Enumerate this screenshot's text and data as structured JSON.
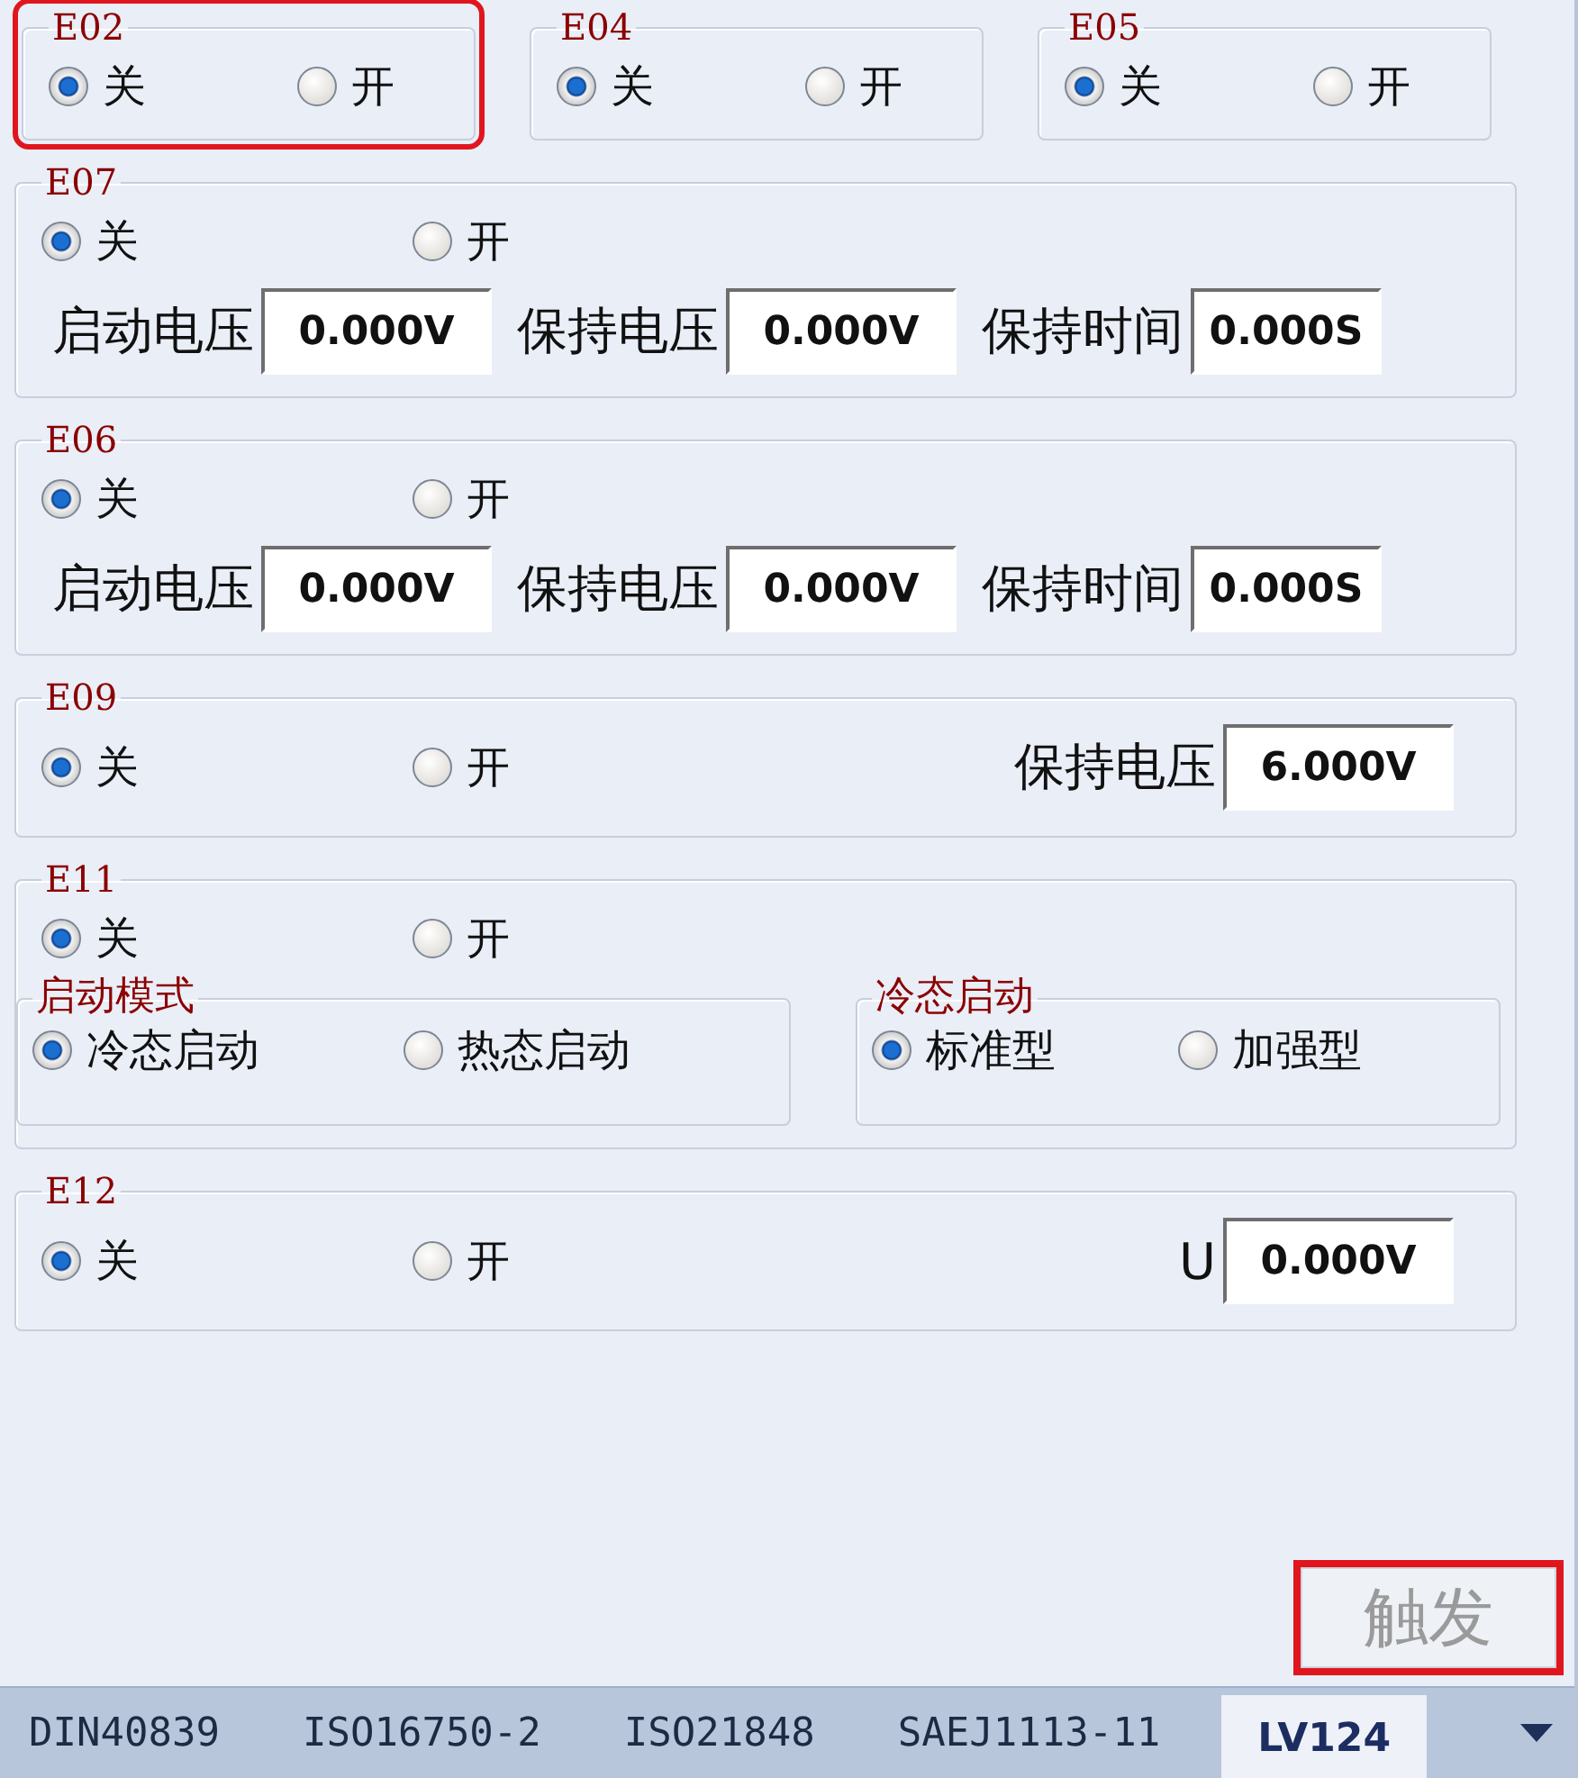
{
  "top_groups": [
    {
      "title": "E02",
      "highlighted": true,
      "options": [
        {
          "label": "关",
          "selected": true
        },
        {
          "label": "开",
          "selected": false
        }
      ]
    },
    {
      "title": "E04",
      "highlighted": false,
      "options": [
        {
          "label": "关",
          "selected": true
        },
        {
          "label": "开",
          "selected": false
        }
      ]
    },
    {
      "title": "E05",
      "highlighted": false,
      "options": [
        {
          "label": "关",
          "selected": true
        },
        {
          "label": "开",
          "selected": false
        }
      ]
    }
  ],
  "groups": [
    {
      "title": "E07",
      "kind": "timing",
      "options": [
        {
          "label": "关",
          "selected": true
        },
        {
          "label": "开",
          "selected": false
        }
      ],
      "fields": [
        {
          "label": "启动电压",
          "value": "0.000V"
        },
        {
          "label": "保持电压",
          "value": "0.000V"
        },
        {
          "label": "保持时间",
          "value": "0.000S"
        }
      ]
    },
    {
      "title": "E06",
      "kind": "timing",
      "options": [
        {
          "label": "关",
          "selected": true
        },
        {
          "label": "开",
          "selected": false
        }
      ],
      "fields": [
        {
          "label": "启动电压",
          "value": "0.000V"
        },
        {
          "label": "保持电压",
          "value": "0.000V"
        },
        {
          "label": "保持时间",
          "value": "0.000S"
        }
      ]
    },
    {
      "title": "E09",
      "kind": "inline",
      "options": [
        {
          "label": "关",
          "selected": true
        },
        {
          "label": "开",
          "selected": false
        }
      ],
      "fields": [
        {
          "label": "保持电压",
          "value": "6.000V"
        }
      ]
    },
    {
      "title": "E11",
      "kind": "modes",
      "options": [
        {
          "label": "关",
          "selected": true
        },
        {
          "label": "开",
          "selected": false
        }
      ],
      "subgroups": [
        {
          "title": "启动模式",
          "options": [
            {
              "label": "冷态启动",
              "selected": true
            },
            {
              "label": "热态启动",
              "selected": false
            }
          ]
        },
        {
          "title": "冷态启动",
          "options": [
            {
              "label": "标准型",
              "selected": true
            },
            {
              "label": "加强型",
              "selected": false
            }
          ]
        }
      ]
    },
    {
      "title": "E12",
      "kind": "inline",
      "options": [
        {
          "label": "关",
          "selected": true
        },
        {
          "label": "开",
          "selected": false
        }
      ],
      "fields": [
        {
          "label": "U",
          "value": "0.000V"
        }
      ]
    }
  ],
  "trigger_button": {
    "label": "触发",
    "disabled": true,
    "highlighted": true
  },
  "tabs": [
    {
      "label": "DIN40839",
      "selected": false
    },
    {
      "label": "ISO16750-2",
      "selected": false
    },
    {
      "label": "ISO21848",
      "selected": false
    },
    {
      "label": "SAEJ1113-11",
      "selected": false
    },
    {
      "label": "LV124",
      "selected": true
    }
  ]
}
